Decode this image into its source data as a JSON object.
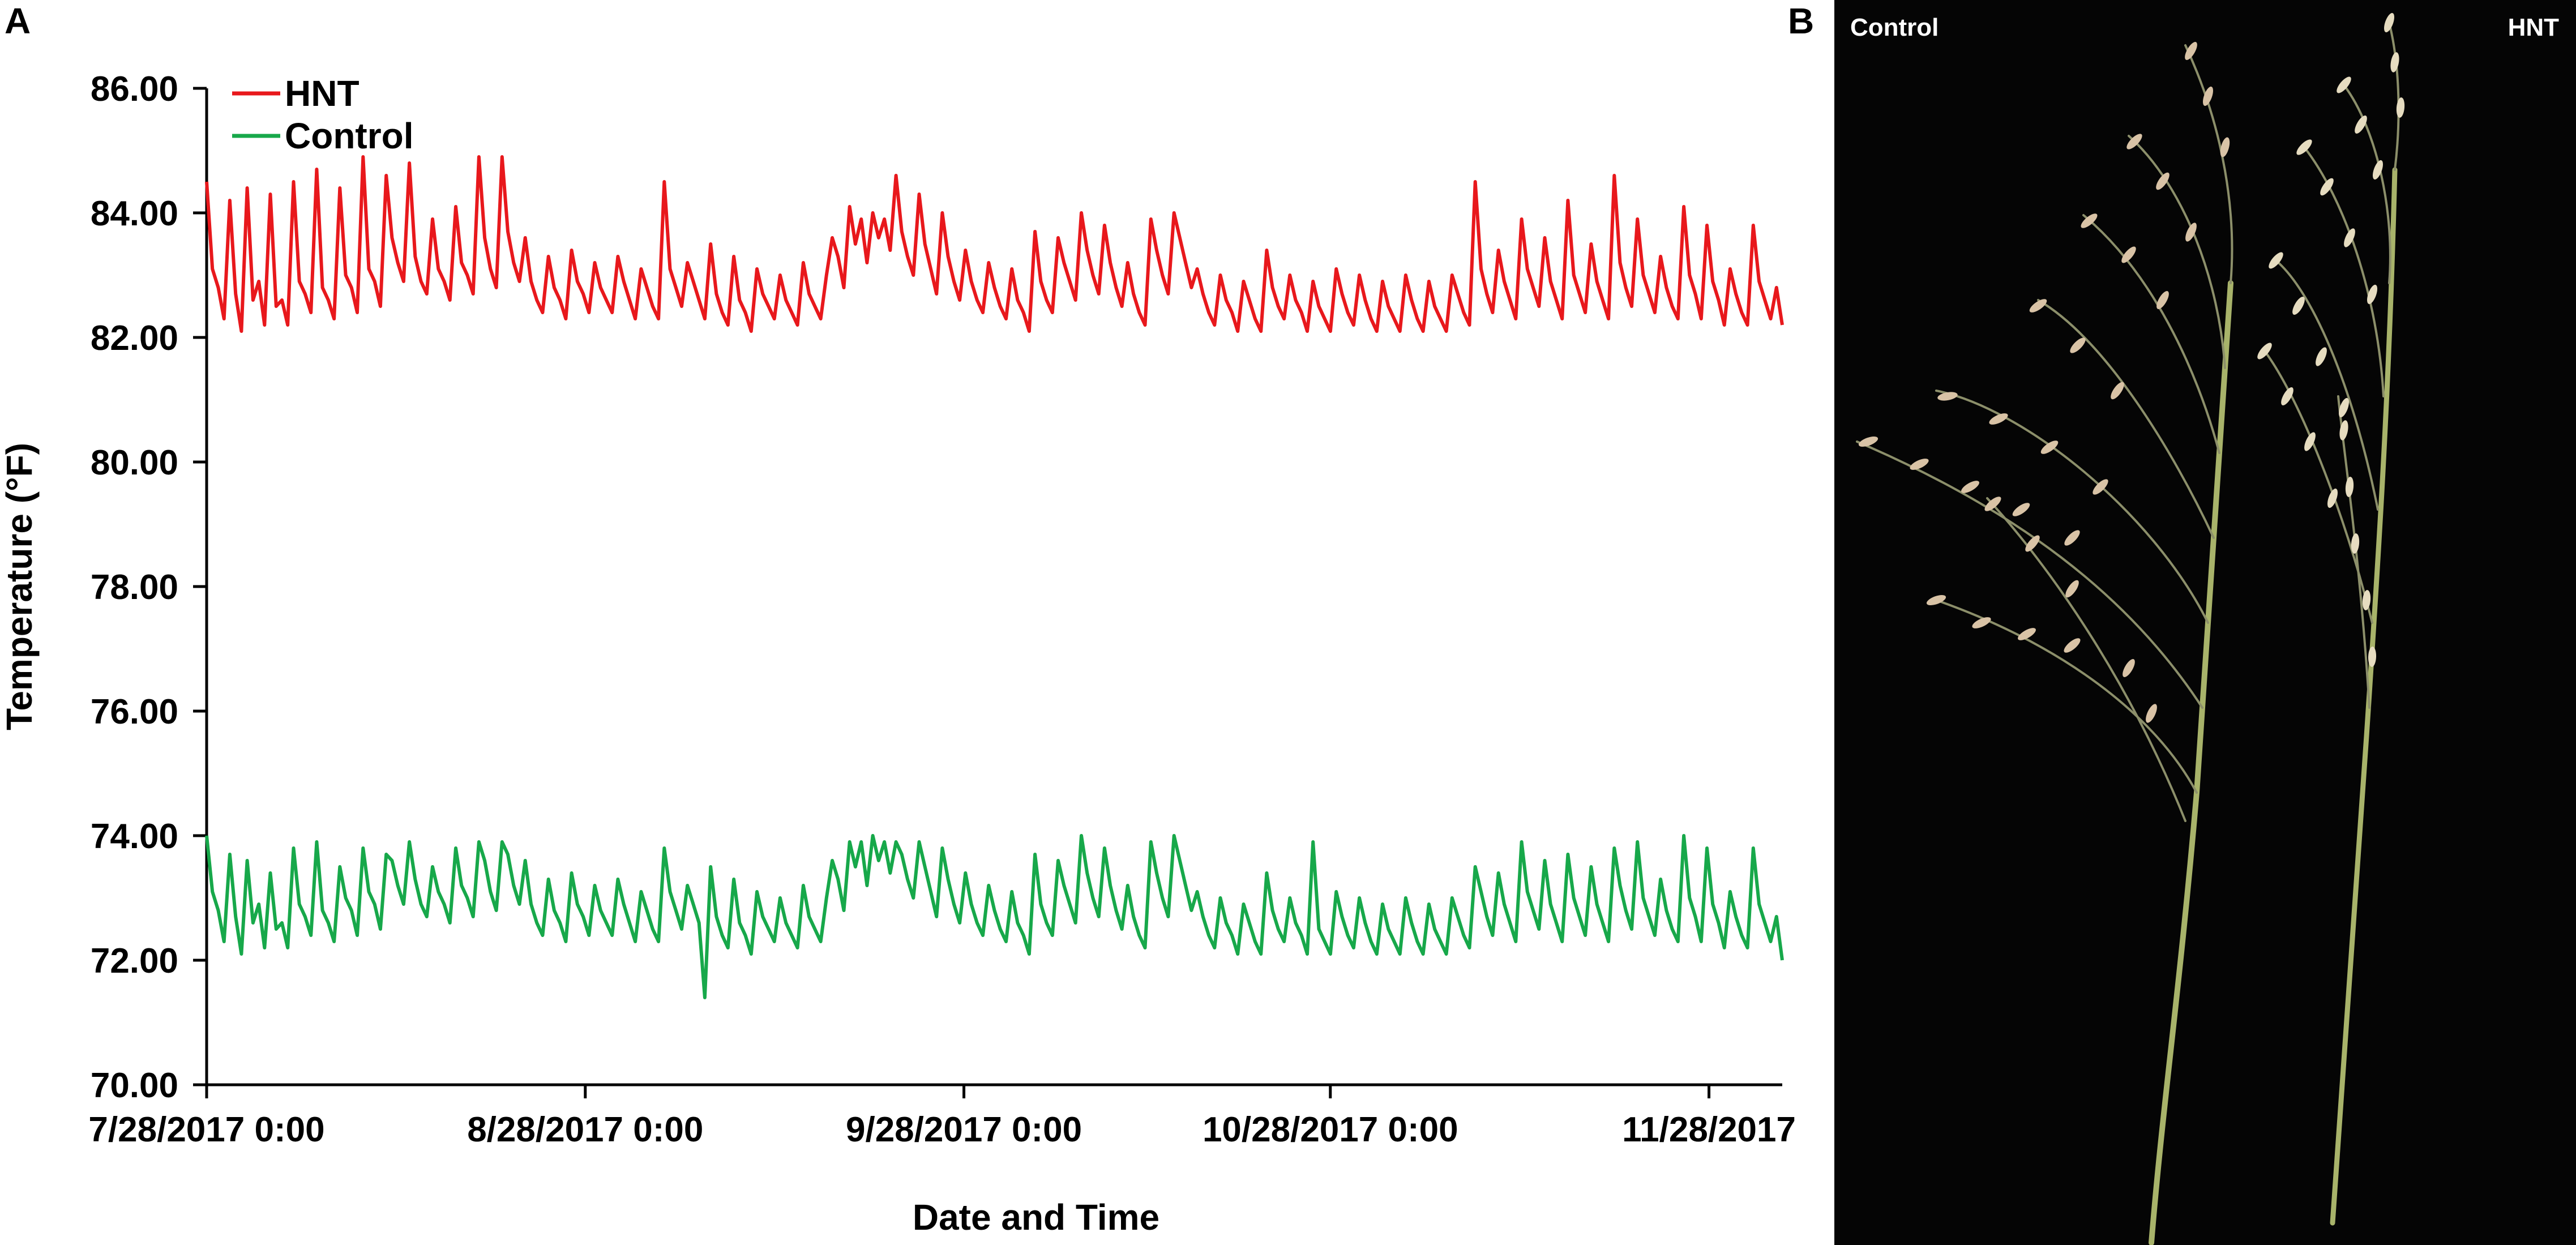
{
  "panel_a_label": "A",
  "panel_b_label": "B",
  "photo": {
    "left_label": "Control",
    "right_label": "HNT"
  },
  "chart_data": {
    "type": "line",
    "title": "",
    "xlabel": "Date and Time",
    "ylabel": "Temperature (°F)",
    "ylim": [
      70,
      86
    ],
    "yticks": [
      "70.00",
      "72.00",
      "74.00",
      "76.00",
      "78.00",
      "80.00",
      "82.00",
      "84.00",
      "86.00"
    ],
    "xlim": [
      "2017-07-28",
      "2017-12-04"
    ],
    "xticks": [
      {
        "date": "2017-07-28",
        "label": "7/28/2017 0:00"
      },
      {
        "date": "2017-08-28",
        "label": "8/28/2017 0:00"
      },
      {
        "date": "2017-09-28",
        "label": "9/28/2017 0:00"
      },
      {
        "date": "2017-10-28",
        "label": "10/28/2017 0:00"
      },
      {
        "date": "2017-11-28",
        "label": "11/28/2017"
      }
    ],
    "grid": false,
    "legend": "top-left",
    "series": [
      {
        "name": "HNT",
        "color": "#e8181c",
        "x_start": "2017-07-28",
        "x_end": "2017-12-04",
        "values": [
          84.5,
          83.1,
          82.8,
          82.3,
          84.2,
          82.7,
          82.1,
          84.4,
          82.6,
          82.9,
          82.2,
          84.3,
          82.5,
          82.6,
          82.2,
          84.5,
          82.9,
          82.7,
          82.4,
          84.7,
          82.8,
          82.6,
          82.3,
          84.4,
          83.0,
          82.8,
          82.4,
          84.9,
          83.1,
          82.9,
          82.5,
          84.6,
          83.6,
          83.2,
          82.9,
          84.8,
          83.3,
          82.9,
          82.7,
          83.9,
          83.1,
          82.9,
          82.6,
          84.1,
          83.2,
          83.0,
          82.7,
          84.9,
          83.6,
          83.1,
          82.8,
          84.9,
          83.7,
          83.2,
          82.9,
          83.6,
          82.9,
          82.6,
          82.4,
          83.3,
          82.8,
          82.6,
          82.3,
          83.4,
          82.9,
          82.7,
          82.4,
          83.2,
          82.8,
          82.6,
          82.4,
          83.3,
          82.9,
          82.6,
          82.3,
          83.1,
          82.8,
          82.5,
          82.3,
          84.5,
          83.1,
          82.8,
          82.5,
          83.2,
          82.9,
          82.6,
          82.3,
          83.5,
          82.7,
          82.4,
          82.2,
          83.3,
          82.6,
          82.4,
          82.1,
          83.1,
          82.7,
          82.5,
          82.3,
          83.0,
          82.6,
          82.4,
          82.2,
          83.2,
          82.7,
          82.5,
          82.3,
          83.0,
          83.6,
          83.3,
          82.8,
          84.1,
          83.5,
          83.9,
          83.2,
          84.0,
          83.6,
          83.9,
          83.4,
          84.6,
          83.7,
          83.3,
          83.0,
          84.3,
          83.5,
          83.1,
          82.7,
          84.0,
          83.3,
          82.9,
          82.6,
          83.4,
          82.9,
          82.6,
          82.4,
          83.2,
          82.8,
          82.5,
          82.3,
          83.1,
          82.6,
          82.4,
          82.1,
          83.7,
          82.9,
          82.6,
          82.4,
          83.6,
          83.2,
          82.9,
          82.6,
          84.0,
          83.4,
          83.0,
          82.7,
          83.8,
          83.2,
          82.8,
          82.5,
          83.2,
          82.7,
          82.4,
          82.2,
          83.9,
          83.4,
          83.0,
          82.7,
          84.0,
          83.6,
          83.2,
          82.8,
          83.1,
          82.7,
          82.4,
          82.2,
          83.0,
          82.6,
          82.4,
          82.1,
          82.9,
          82.6,
          82.3,
          82.1,
          83.4,
          82.8,
          82.5,
          82.3,
          83.0,
          82.6,
          82.4,
          82.1,
          82.9,
          82.5,
          82.3,
          82.1,
          83.1,
          82.7,
          82.4,
          82.2,
          83.0,
          82.6,
          82.3,
          82.1,
          82.9,
          82.5,
          82.3,
          82.1,
          83.0,
          82.6,
          82.3,
          82.1,
          82.9,
          82.5,
          82.3,
          82.1,
          83.0,
          82.7,
          82.4,
          82.2,
          84.5,
          83.1,
          82.7,
          82.4,
          83.4,
          82.9,
          82.6,
          82.3,
          83.9,
          83.1,
          82.8,
          82.5,
          83.6,
          82.9,
          82.6,
          82.3,
          84.2,
          83.0,
          82.7,
          82.4,
          83.5,
          82.9,
          82.6,
          82.3,
          84.6,
          83.2,
          82.8,
          82.5,
          83.9,
          83.0,
          82.7,
          82.4,
          83.3,
          82.8,
          82.5,
          82.3,
          84.1,
          83.0,
          82.7,
          82.3,
          83.8,
          82.9,
          82.6,
          82.2,
          83.1,
          82.7,
          82.4,
          82.2,
          83.8,
          82.9,
          82.6,
          82.3,
          82.8,
          82.2
        ]
      },
      {
        "name": "Control",
        "color": "#17a84a",
        "x_start": "2017-07-28",
        "x_end": "2017-12-04",
        "values": [
          74.0,
          73.1,
          72.8,
          72.3,
          73.7,
          72.7,
          72.1,
          73.6,
          72.6,
          72.9,
          72.2,
          73.4,
          72.5,
          72.6,
          72.2,
          73.8,
          72.9,
          72.7,
          72.4,
          73.9,
          72.8,
          72.6,
          72.3,
          73.5,
          73.0,
          72.8,
          72.4,
          73.8,
          73.1,
          72.9,
          72.5,
          73.7,
          73.6,
          73.2,
          72.9,
          73.9,
          73.3,
          72.9,
          72.7,
          73.5,
          73.1,
          72.9,
          72.6,
          73.8,
          73.2,
          73.0,
          72.7,
          73.9,
          73.6,
          73.1,
          72.8,
          73.9,
          73.7,
          73.2,
          72.9,
          73.6,
          72.9,
          72.6,
          72.4,
          73.3,
          72.8,
          72.6,
          72.3,
          73.4,
          72.9,
          72.7,
          72.4,
          73.2,
          72.8,
          72.6,
          72.4,
          73.3,
          72.9,
          72.6,
          72.3,
          73.1,
          72.8,
          72.5,
          72.3,
          73.8,
          73.1,
          72.8,
          72.5,
          73.2,
          72.9,
          72.6,
          71.4,
          73.5,
          72.7,
          72.4,
          72.2,
          73.3,
          72.6,
          72.4,
          72.1,
          73.1,
          72.7,
          72.5,
          72.3,
          73.0,
          72.6,
          72.4,
          72.2,
          73.2,
          72.7,
          72.5,
          72.3,
          73.0,
          73.6,
          73.3,
          72.8,
          73.9,
          73.5,
          73.9,
          73.2,
          74.0,
          73.6,
          73.9,
          73.4,
          73.9,
          73.7,
          73.3,
          73.0,
          73.9,
          73.5,
          73.1,
          72.7,
          73.8,
          73.3,
          72.9,
          72.6,
          73.4,
          72.9,
          72.6,
          72.4,
          73.2,
          72.8,
          72.5,
          72.3,
          73.1,
          72.6,
          72.4,
          72.1,
          73.7,
          72.9,
          72.6,
          72.4,
          73.6,
          73.2,
          72.9,
          72.6,
          74.0,
          73.4,
          73.0,
          72.7,
          73.8,
          73.2,
          72.8,
          72.5,
          73.2,
          72.7,
          72.4,
          72.2,
          73.9,
          73.4,
          73.0,
          72.7,
          74.0,
          73.6,
          73.2,
          72.8,
          73.1,
          72.7,
          72.4,
          72.2,
          73.0,
          72.6,
          72.4,
          72.1,
          72.9,
          72.6,
          72.3,
          72.1,
          73.4,
          72.8,
          72.5,
          72.3,
          73.0,
          72.6,
          72.4,
          72.1,
          73.9,
          72.5,
          72.3,
          72.1,
          73.1,
          72.7,
          72.4,
          72.2,
          73.0,
          72.6,
          72.3,
          72.1,
          72.9,
          72.5,
          72.3,
          72.1,
          73.0,
          72.6,
          72.3,
          72.1,
          72.9,
          72.5,
          72.3,
          72.1,
          73.0,
          72.7,
          72.4,
          72.2,
          73.5,
          73.1,
          72.7,
          72.4,
          73.4,
          72.9,
          72.6,
          72.3,
          73.9,
          73.1,
          72.8,
          72.5,
          73.6,
          72.9,
          72.6,
          72.3,
          73.7,
          73.0,
          72.7,
          72.4,
          73.5,
          72.9,
          72.6,
          72.3,
          73.8,
          73.2,
          72.8,
          72.5,
          73.9,
          73.0,
          72.7,
          72.4,
          73.3,
          72.8,
          72.5,
          72.3,
          74.0,
          73.0,
          72.7,
          72.3,
          73.8,
          72.9,
          72.6,
          72.2,
          73.1,
          72.7,
          72.4,
          72.2,
          73.8,
          72.9,
          72.6,
          72.3,
          72.7,
          72.0
        ]
      }
    ]
  }
}
